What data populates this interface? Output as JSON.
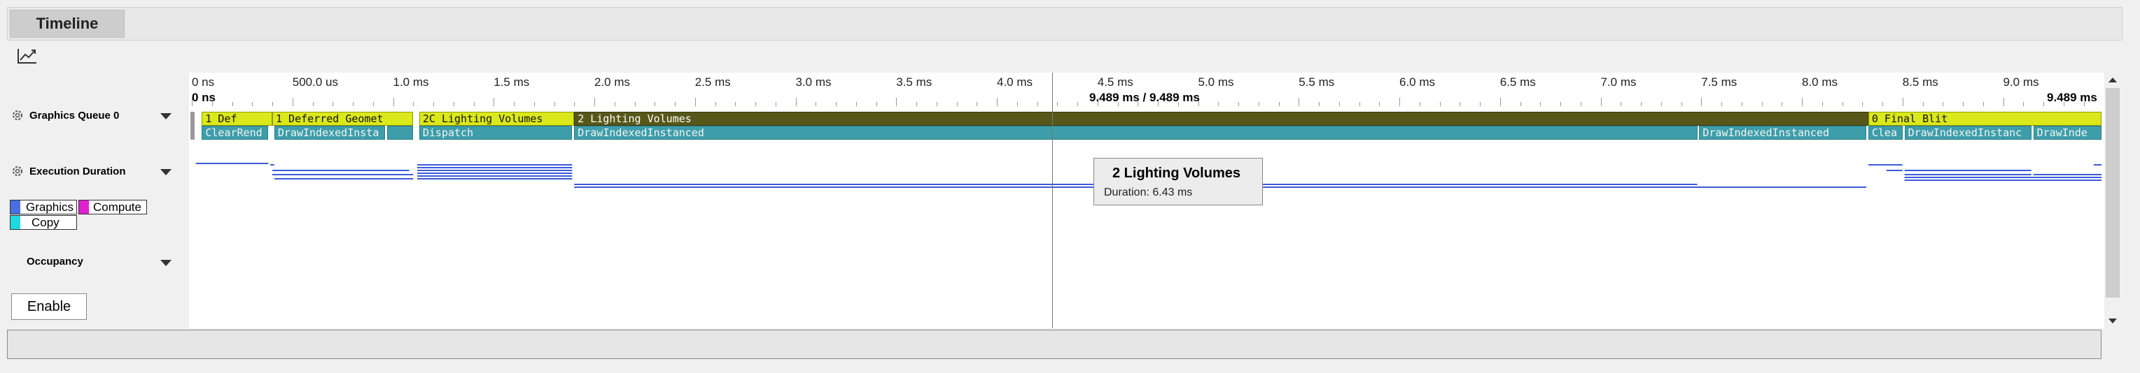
{
  "tab": {
    "label": "Timeline"
  },
  "toolbar": {
    "icon": "line-chart-icon"
  },
  "rows": {
    "queue_label": "Graphics Queue 0",
    "exec_label": "Execution Duration",
    "occupancy_label": "Occupancy"
  },
  "legend": [
    {
      "label": "Graphics",
      "color": "#4a6fe0"
    },
    {
      "label": "Compute",
      "color": "#e020d0"
    },
    {
      "label": "Copy",
      "color": "#20d8e0"
    }
  ],
  "enable_button": "Enable",
  "ruler": {
    "start_label": "0 ns",
    "ticks": [
      "0 ns",
      "500.0 us",
      "1.0 ms",
      "1.5 ms",
      "2.0 ms",
      "2.5 ms",
      "3.0 ms",
      "3.5 ms",
      "4.0 ms",
      "4.5 ms",
      "5.0 ms",
      "5.5 ms",
      "6.0 ms",
      "6.5 ms",
      "7.0 ms",
      "7.5 ms",
      "8.0 ms",
      "8.5 ms",
      "9.0 ms"
    ],
    "center_label": "9.489 ms / 9.489 ms",
    "end_label": "9.489 ms"
  },
  "top_bars": [
    {
      "label": "1   Def",
      "style": "yellow",
      "start_ms": 0.05,
      "end_ms": 0.4
    },
    {
      "label": "1   Deferred Geomet",
      "style": "yellow",
      "start_ms": 0.4,
      "end_ms": 1.1
    },
    {
      "label": "2C  Lighting Volumes",
      "style": "yellow",
      "start_ms": 1.13,
      "end_ms": 1.9
    },
    {
      "label": "2   Lighting Volumes",
      "style": "olive",
      "start_ms": 1.9,
      "end_ms": 8.33
    },
    {
      "label": "0   Final Blit",
      "style": "yellow",
      "start_ms": 8.33,
      "end_ms": 9.489
    }
  ],
  "sub_bars": [
    {
      "label": "ClearRend",
      "start_ms": 0.05,
      "end_ms": 0.38
    },
    {
      "label": "DrawIndexedInsta",
      "start_ms": 0.41,
      "end_ms": 0.96
    },
    {
      "label": "",
      "start_ms": 0.97,
      "end_ms": 1.1
    },
    {
      "label": "Dispatch",
      "start_ms": 1.13,
      "end_ms": 1.89
    },
    {
      "label": "DrawIndexedInstanced",
      "start_ms": 1.9,
      "end_ms": 7.48
    },
    {
      "label": "DrawIndexedInstanced",
      "start_ms": 7.49,
      "end_ms": 8.32
    },
    {
      "label": "Clea",
      "start_ms": 8.33,
      "end_ms": 8.5
    },
    {
      "label": "DrawIndexedInstanc",
      "start_ms": 8.51,
      "end_ms": 9.14
    },
    {
      "label": "DrawInde",
      "start_ms": 9.15,
      "end_ms": 9.489
    }
  ],
  "tooltip": {
    "title": "2   Lighting Volumes",
    "duration": "Duration: 6.43 ms"
  }
}
